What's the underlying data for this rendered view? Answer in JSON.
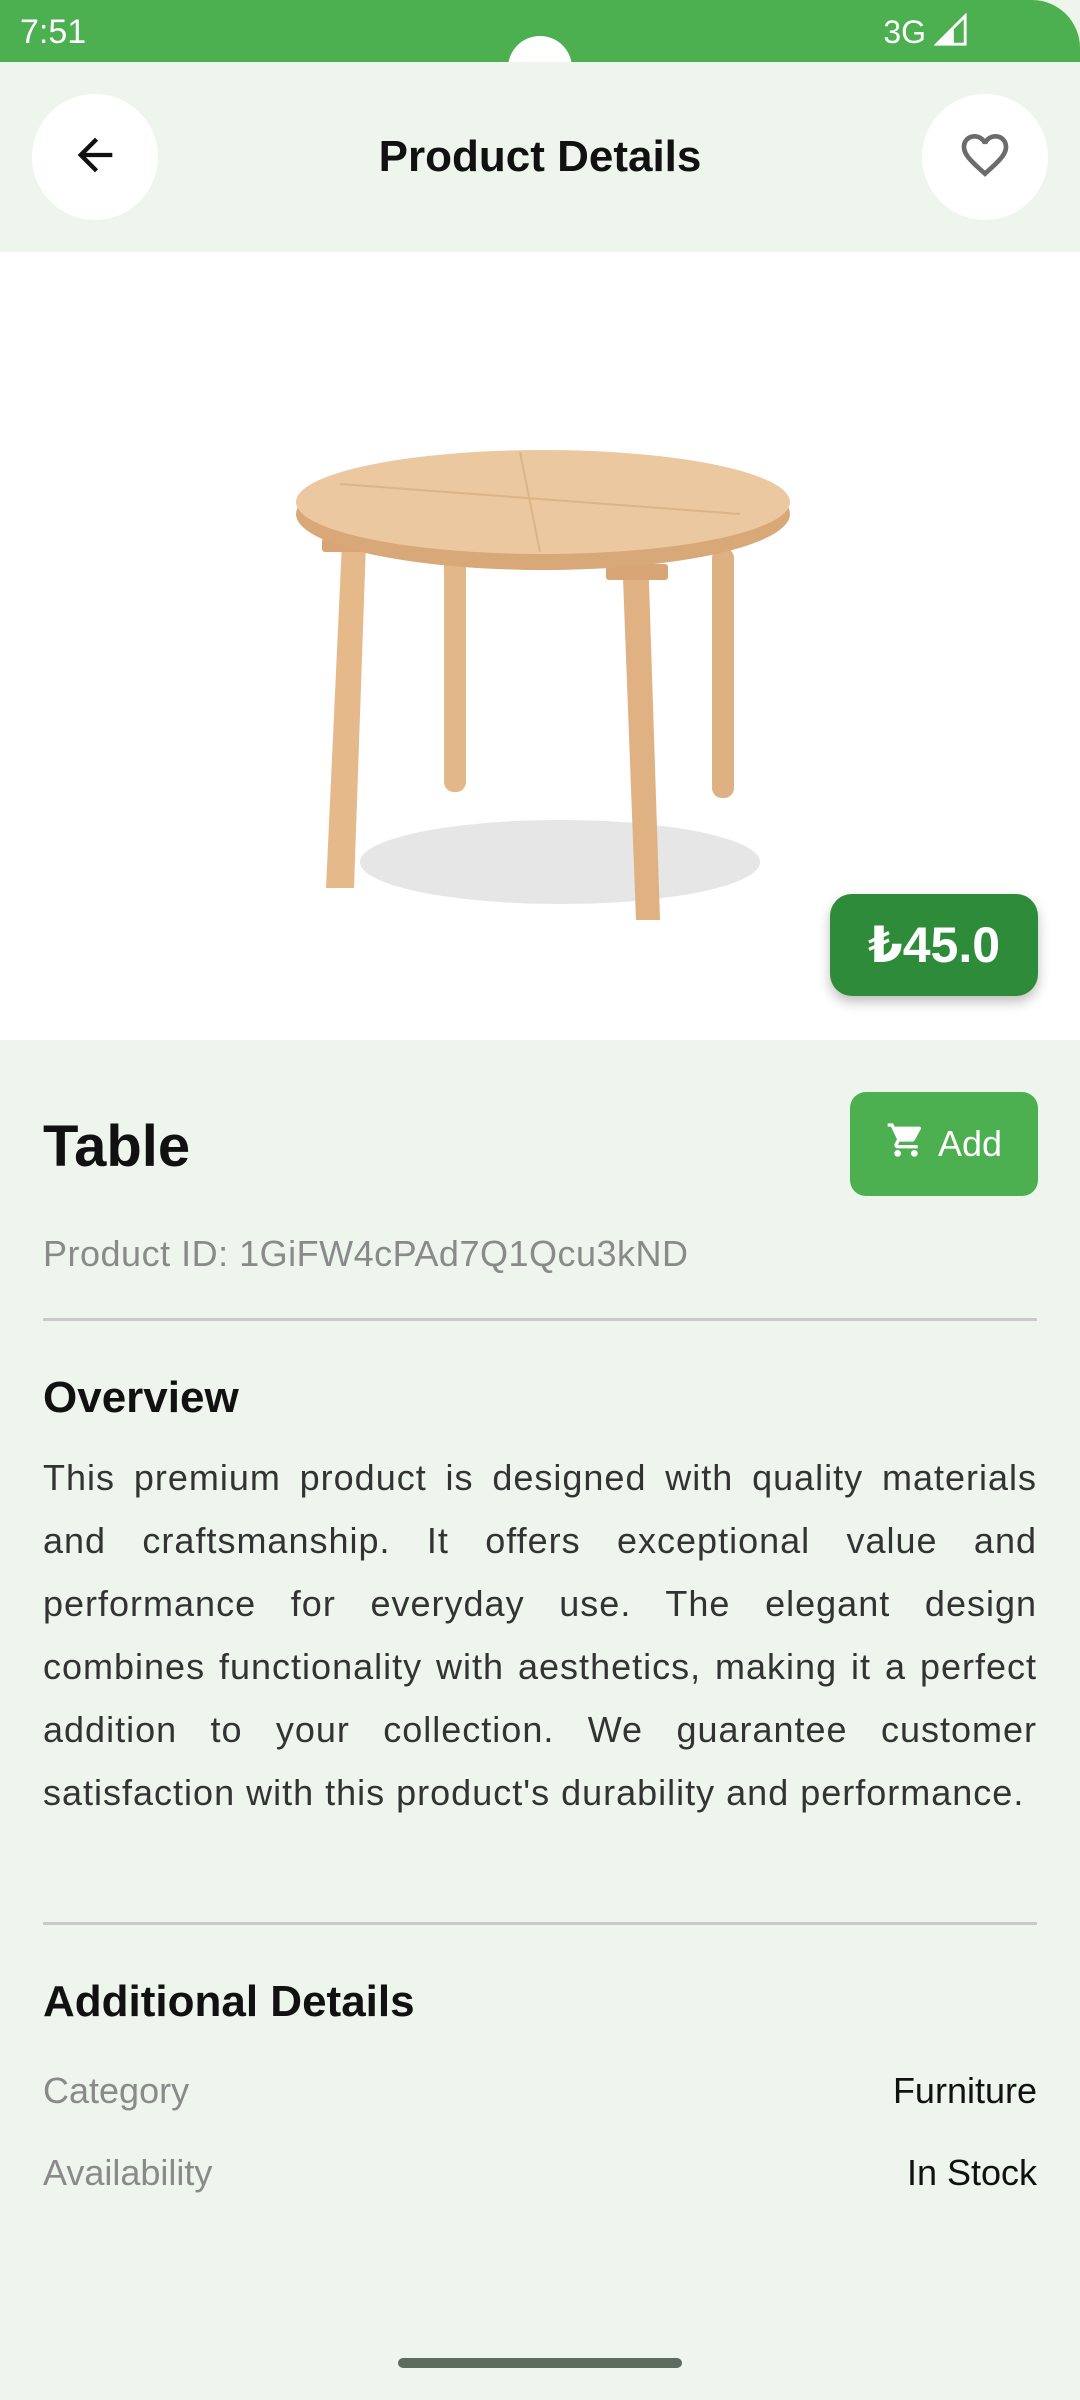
{
  "status_bar": {
    "time": "7:51",
    "network": "3G"
  },
  "app_bar": {
    "title": "Product Details",
    "back_icon": "arrow-left-icon",
    "favorite_icon": "heart-outline-icon"
  },
  "product": {
    "image_alt": "wooden-round-table-image",
    "price": "₺45.0",
    "name": "Table",
    "add_button_label": "Add",
    "id_text": "Product ID: 1GiFW4cPAd7Q1Qcu3kND"
  },
  "overview": {
    "title": "Overview",
    "text": "This premium product is designed with quality materials and craftsmanship. It offers exceptional value and performance for everyday use. The elegant design combines functionality with aesthetics, making it a perfect addition to your collection. We guarantee customer satisfaction with this product's durability and performance."
  },
  "additional": {
    "title": "Additional Details",
    "rows": [
      {
        "label": "Category",
        "value": "Furniture"
      },
      {
        "label": "Availability",
        "value": "In Stock"
      }
    ]
  },
  "colors": {
    "primary": "#4caf50",
    "primary_dark": "#2e8b3a",
    "background": "#edf5ed"
  }
}
